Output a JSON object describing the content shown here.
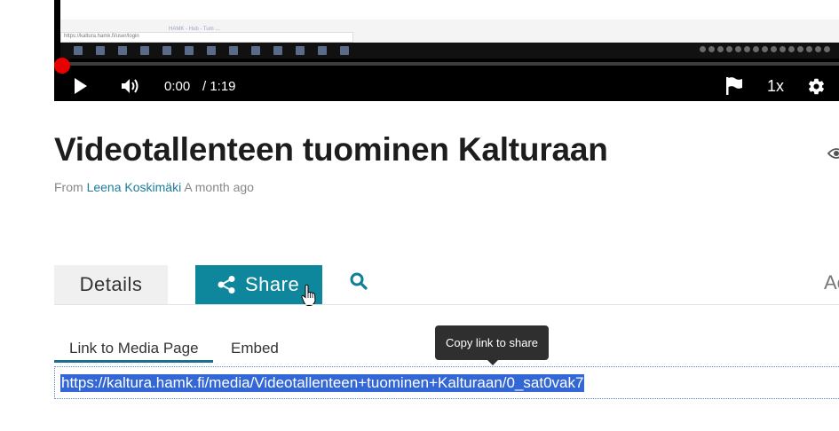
{
  "player": {
    "current_time": "0:00",
    "duration": "/ 1:19",
    "speed": "1x",
    "progress_fraction": 0,
    "inner_page_text": "HAMK - Hub - Tum ...",
    "inner_url": "https://kaltura.hamk.fi/user/login",
    "colors": {
      "progress": "#e00000",
      "background": "#000000"
    }
  },
  "media": {
    "title": "Videotallenteen tuominen Kalturaan",
    "from_label": "From",
    "author": "Leena Koskimäki",
    "posted": "A month ago"
  },
  "tabs": {
    "details": "Details",
    "share": "Share",
    "actions_partial": "Ac"
  },
  "share": {
    "subtabs": [
      "Link to Media Page",
      "Embed"
    ],
    "tooltip": "Copy link to share",
    "link": "https://kaltura.hamk.fi/media/Videotallenteen+tuominen+Kalturaan/0_sat0vak7"
  },
  "colors": {
    "accent": "#0e879c",
    "link": "#1d7d9b",
    "selection": "#3367d6"
  }
}
